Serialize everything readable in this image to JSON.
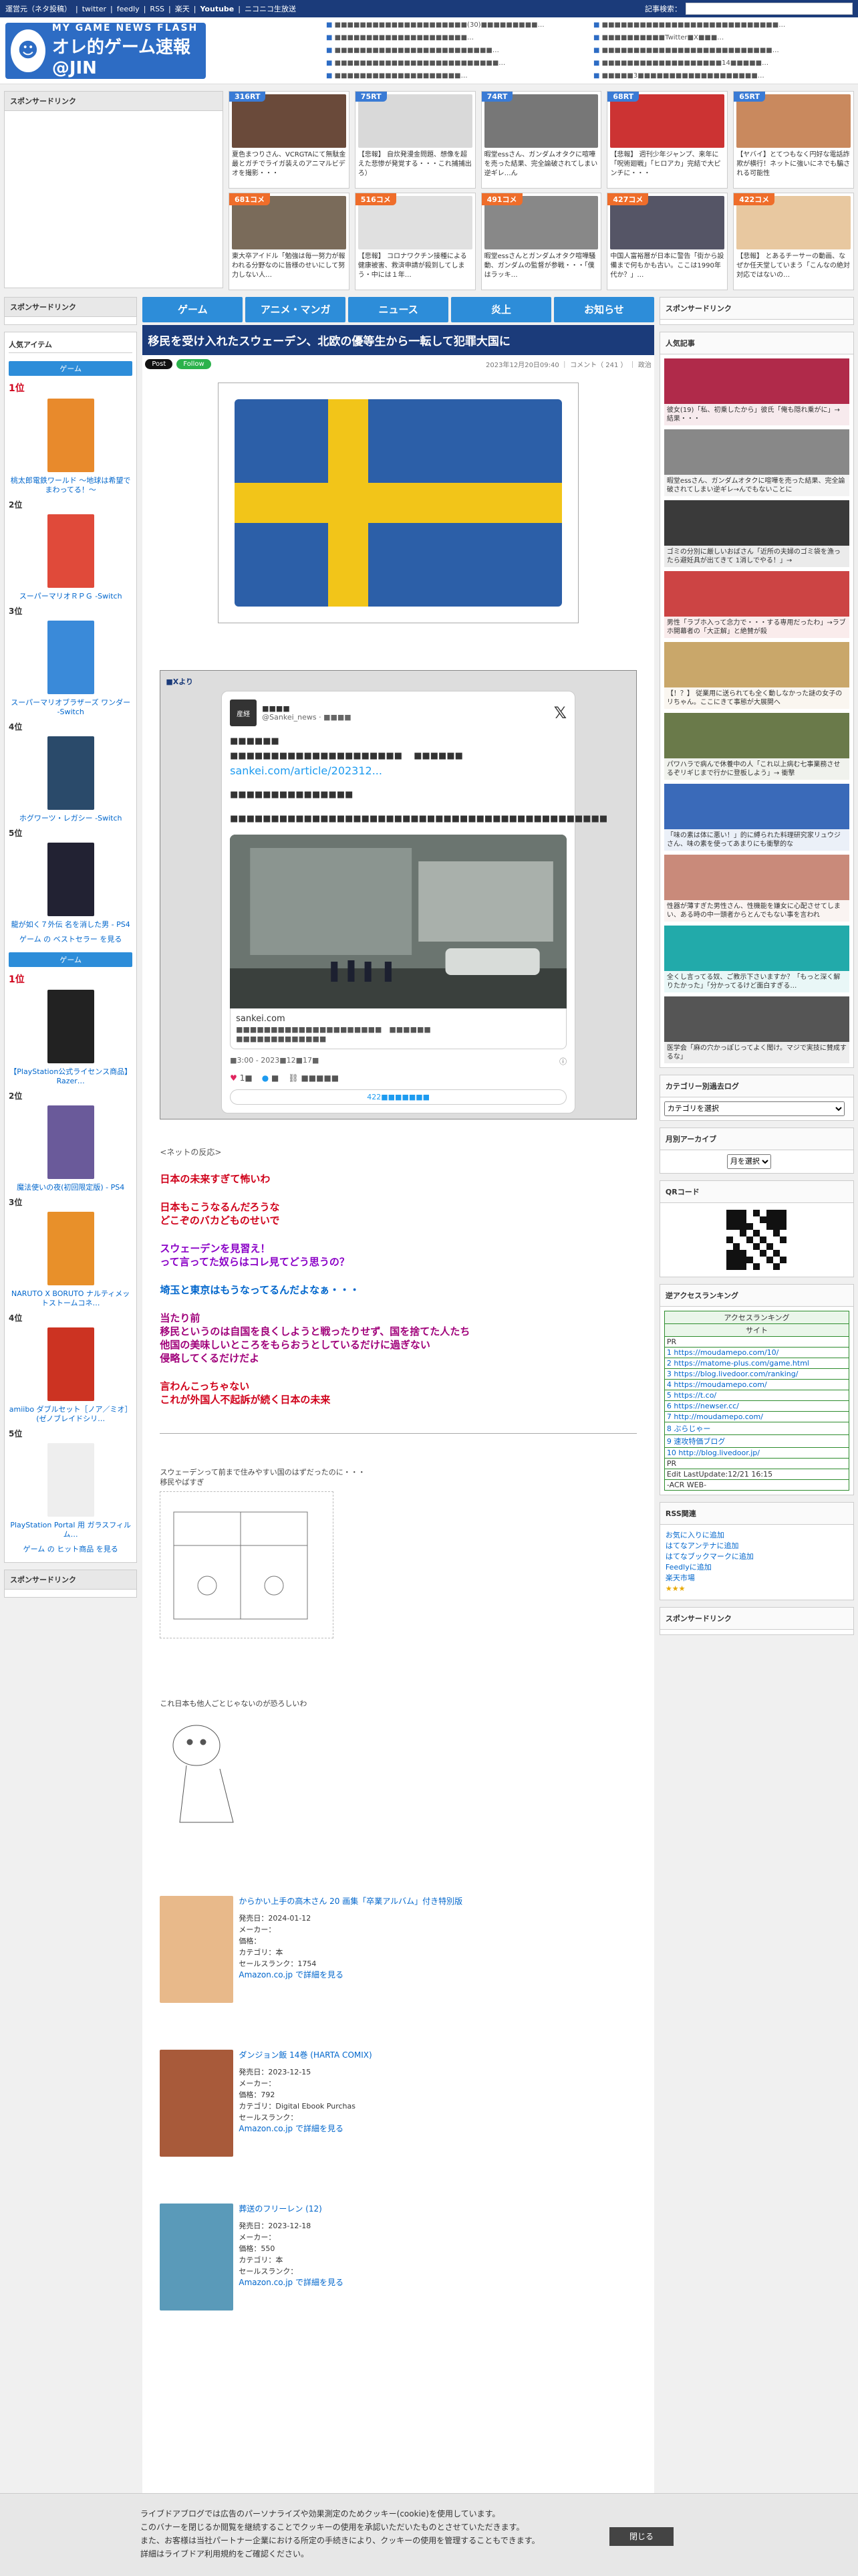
{
  "topbar": {
    "links": [
      "運営元（ネタ投稿）",
      "twitter",
      "feedly",
      "RSS",
      "楽天",
      "Youtube",
      "ニコニコ生放送"
    ],
    "search_label": "記事検索："
  },
  "logo": {
    "line1": "MY GAME NEWS FLASH",
    "line2": "オレ的ゲーム速報@JIN"
  },
  "head_links": [
    [
      "■■■■■■■■■■■■■■■■■■■■■(30)■■■■■■■■■…",
      "■■■■■■■■■■■■■■■■■■■■■…",
      "■■■■■■■■■■■■■■■■■■■■■■■■■…",
      "■■■■■■■■■■■■■■■■■■■■■■■■■■…",
      "■■■■■■■■■■■■■■■■■■■■…"
    ],
    [
      "■■■■■■■■■■■■■■■■■■■■■■■■■■■■…",
      "■■■■■■■■■■Twitter■X■■■…",
      "■■■■■■■■■■■■■■■■■■■■■■■■■■■…",
      "■■■■■■■■■■■■■■■■■■■14■■■■■…",
      "■■■■■3■■■■■■■■■■■■■■■■■■■…"
    ]
  ],
  "sponsor_label": "スポンサードリンク",
  "grid": [
    {
      "badge": "316RT",
      "orange": false,
      "text": "夏色まつりさん、VCRGTAにて無駄金最とガチでライガ装えのアニマルビデオを撮影・・・",
      "c": "#6a4a3a"
    },
    {
      "badge": "75RT",
      "orange": false,
      "text": "【悲報】 自炊発漫金問題、想像を超えた悲惨が発覚する・・・これ捕捕出ろ）",
      "c": "#d9d9d9"
    },
    {
      "badge": "74RT",
      "orange": false,
      "text": "暇堂essさん、ガンダムオタクに喧嘩を売った結果、完全論破されてしまい逆ギレ…ん",
      "c": "#777"
    },
    {
      "badge": "68RT",
      "orange": false,
      "text": "【悲報】 週刊少年ジャンプ、来年に「呪術廻戦」「ヒロアカ」完結で大ピンチに・・・",
      "c": "#c33"
    },
    {
      "badge": "65RT",
      "orange": false,
      "text": "【ヤバイ】とてつもなく円好な電話詐欺が横行！ネットに強いにネでも騙される可能性",
      "c": "#c9895e"
    },
    {
      "badge": "681コメ",
      "orange": true,
      "text": "東大卒アイドル「勉強は毎一努力が報われる分野なのに皆様のせいにして努力しない人…",
      "c": "#7a6b5a"
    },
    {
      "badge": "516コメ",
      "orange": true,
      "text": "【悲報】 コロナワクチン接種による健康被害、救済申請が殺到してしまう・中には１年…",
      "c": "#e0e0e0"
    },
    {
      "badge": "491コメ",
      "orange": true,
      "text": "暇堂essさんとガンダムオタク喧嘩騒動、ガンダムの監督が参戦・・・「僕はラッキ…",
      "c": "#888"
    },
    {
      "badge": "427コメ",
      "orange": true,
      "text": "中国人富裕層が日本に警告「街から設備まで何もかも古い。ここは1990年代か？」…",
      "c": "#556"
    },
    {
      "badge": "422コメ",
      "orange": true,
      "text": "【悲報】 とあるチーサーの動画、なぜか任天堂していまう「こんなの絶対対応ではないの…",
      "c": "#e8c8a0"
    }
  ],
  "nav": [
    "ゲーム",
    "アニメ・マンガ",
    "ニュース",
    "炎上",
    "お知らせ"
  ],
  "left": {
    "sponsor": "スポンサードリンク",
    "popular": "人気アイテム",
    "tab1": "ゲーム",
    "games": [
      {
        "pos": "1位",
        "title": "桃太郎電鉄ワールド ～地球は希望でまわってる！～",
        "c": "#e88a2c"
      },
      {
        "pos": "2位",
        "title": "スーパーマリオＲＰＧ -Switch",
        "c": "#e04a3a"
      },
      {
        "pos": "3位",
        "title": "スーパーマリオブラザーズ ワンダー -Switch",
        "c": "#3a8ad9"
      },
      {
        "pos": "4位",
        "title": "ホグワーツ・レガシー -Switch",
        "c": "#2a4a6a"
      },
      {
        "pos": "5位",
        "title": "龍が如く７外伝 名を消した男 - PS4",
        "c": "#223"
      }
    ],
    "more1": "ゲーム の ベストセラー を見る",
    "tab2": "ゲーム",
    "games2": [
      {
        "pos": "1位",
        "title": "【PlayStation公式ライセンス商品】 Razer…",
        "c": "#222"
      },
      {
        "pos": "2位",
        "title": "魔法使いの夜(初回限定版) - PS4",
        "c": "#6a5a9a"
      },
      {
        "pos": "3位",
        "title": "NARUTO X BORUTO ナルティメットストームコネ…",
        "c": "#e8902a"
      },
      {
        "pos": "4位",
        "title": "amiibo ダブルセット［ノア／ミオ］ (ゼノブレイドシリ…",
        "c": "#c32"
      },
      {
        "pos": "5位",
        "title": "PlayStation Portal 用 ガラスフィルム…",
        "c": "#eee"
      }
    ],
    "more2": "ゲーム の ヒット商品 を見る",
    "sponsor2": "スポンサードリンク"
  },
  "article": {
    "title": "移民を受け入れたスウェーデン、北欧の優等生から一転して犯罪大国に",
    "post": "Post",
    "follow": "Follow",
    "meta": "2023年12月20日09:40 ｜ コメント（ 241 ） ｜ 政治",
    "embed_from": "■Xより",
    "tweet": {
      "name": "■■■■",
      "handle": "@Sankei_news · ■■■■",
      "l1": "■■■■■■",
      "l2": "■■■■■■■■■■■■■■■■■■■■■ 　■■■■■■",
      "link": "sankei.com/article/202312...",
      "l3": "■■■■■■■■■■■■■■■",
      "l4": "■■■■■■■■■■■■■■■■■■■■■■■■■■■■■■■■■■■■■■■■■■■■■■",
      "site": "sankei.com",
      "site2": "■■■■■■■■■■■■■■■■■■■■■　■■■■■■",
      "site3": "■■■■■■■■■■■■■",
      "time": "■3:00 - 2023■12■17■",
      "likes": "1■",
      "reply": "■",
      "copy": "■■■■■",
      "replies": "422■■■■■■■"
    },
    "reaction": "<ネットの反応>",
    "comments": [
      {
        "cls": "red",
        "text": "日本の未来すぎて怖いわ"
      },
      {
        "cls": "red",
        "text": "日本もこうなるんだろうな\nどこぞのバカどものせいで"
      },
      {
        "cls": "purple",
        "text": "スウェーデンを見習え！\nって言ってた奴らはコレ見てどう思うの？"
      },
      {
        "cls": "blue",
        "text": "埼玉と東京はもうなってるんだよなぁ・・・"
      },
      {
        "cls": "magenta",
        "text": "当たり前\n移民というのは自国を良くしようと戦ったりせず、国を捨てた人たち\n他国の美味しいところをもらおうとしているだけに過ぎない\n侵略してくるだけだよ"
      },
      {
        "cls": "red",
        "text": "言わんこっちゃない\nこれが外国人不起訴が続く日本の未来"
      }
    ],
    "aa1": "スウェーデンって前まで住みやすい国のはずだったのに・・・\n移民やばすぎ",
    "aa2": "これ日本も他人ごとじゃないのが恐ろしいわ",
    "products": [
      {
        "title": "からかい上手の高木さん 20 画集「卒業アルバム」付き特別版",
        "date": "発売日：2024-01-12",
        "maker": "メーカー：",
        "price": "価格：",
        "cat": "カテゴリ：本",
        "rank": "セールスランク：1754",
        "link": "Amazon.co.jp で詳細を見る",
        "c": "#e8b98a"
      },
      {
        "title": "ダンジョン飯 14巻 (HARTA COMIX)",
        "date": "発売日：2023-12-15",
        "maker": "メーカー：",
        "price": "価格：792",
        "cat": "カテゴリ：Digital Ebook Purchas",
        "rank": "セールスランク：",
        "link": "Amazon.co.jp で詳細を見る",
        "c": "#a85a3a"
      },
      {
        "title": "葬送のフリーレン (12)",
        "date": "発売日：2023-12-18",
        "maker": "メーカー：",
        "price": "価格：550",
        "cat": "カテゴリ：本",
        "rank": "セールスランク：",
        "link": "Amazon.co.jp で詳細を見る",
        "c": "#5a9ab9"
      }
    ]
  },
  "right": {
    "sponsor": "スポンサードリンク",
    "popular": "人気記事",
    "pop": [
      {
        "text": "彼女(19)「私、初乗したから」彼氏「俺も隠れ乗がに」→ 結果・・・",
        "c": "#b02a4a"
      },
      {
        "text": "暇堂essさん、ガンダムオタクに喧嘩を売った結果、完全論破されてしまい逆ギレ→んでもないことに",
        "c": "#888"
      },
      {
        "text": "ゴミの分別に厳しいおばさん「近所の夫婦のゴミ袋を漁ったら避妊具が出てきて 1消しでやる！」→",
        "c": "#3a3a3a"
      },
      {
        "text": "男性「ラブホ入って念力で・・・する専用だったわ」→ラブホ開幕者の「大正解」と絶賛が殺",
        "c": "#c44"
      },
      {
        "text": "【！？】 従業用に送られても全く動しなかった謎の女子のリちゃん。ここにきて事態が大展開へ",
        "c": "#c9a76a"
      },
      {
        "text": "パワハラで病んで休養中の人「これ以上病む七事業務させるぞリギじまで行かに登板しよう」→ 衝撃",
        "c": "#6a7a4a"
      },
      {
        "text": "「味の素は体に悪い！」的に縛られた料理研究家リュウジさん、味の素を使ってあまりにも衝撃的な",
        "c": "#3a6ab9"
      },
      {
        "text": "性器が薄すぎた男性さん、性機能を嫌女に心配させてしまい、ある時の中一頭者からとんでもない事を言われ",
        "c": "#c98a7a"
      },
      {
        "text": "全くし言ってる奴、ご教示下さいますか？「もっと深く解りたかった」「分かってるけど面白すぎる…",
        "c": "#2aa"
      },
      {
        "text": "医学会「麻の穴かっぽじってよく聞け。マジで実技に賛成するな」",
        "c": "#555"
      }
    ],
    "catlog": "カテゴリー別過去ログ",
    "catsel": "カテゴリを選択",
    "monthly": "月別アーカイブ",
    "monthsel": "月を選択",
    "qr": "QRコード",
    "rev": "逆アクセスランキング",
    "acr_head": "アクセスランキング",
    "acr_site": "サイト",
    "acr": [
      "PR",
      "1 https://moudamepo.com/10/",
      "2 https://matome-plus.com/game.html",
      "3 https://blog.livedoor.com/ranking/",
      "4 https://moudamepo.com/",
      "5 https://t.co/",
      "6 https://newser.cc/",
      "7 http://moudamepo.com/",
      "8 ぶらじゃー",
      "9 速攻特価ブログ",
      "10 http://blog.livedoor.jp/",
      "PR",
      "Edit LastUpdate:12/21 16:15",
      "-ACR WEB-"
    ],
    "rss": "RSS関連",
    "rss_links": [
      "お気に入りに追加",
      "はてなアンテナに追加",
      "はてなブックマークに追加",
      "Feedlyに追加",
      "楽天市場"
    ],
    "sponsor2": "スポンサードリンク"
  },
  "cookie": {
    "l1": "ライブドアブログでは広告のパーソナライズや効果測定のためクッキー(cookie)を使用しています。",
    "l2": "このバナーを閉じるか閲覧を継続することでクッキーの使用を承認いただいたものとさせていただきます。",
    "l3": "また、お客様は当社パートナー企業における所定の手続きにより、クッキーの使用を管理することもできます。",
    "l4": "詳細はライブドア利用規約をご確認ください。",
    "close": "閉じる"
  },
  "colors": {
    "brand": "#1b3b7a",
    "accent": "#2d8dd9"
  }
}
